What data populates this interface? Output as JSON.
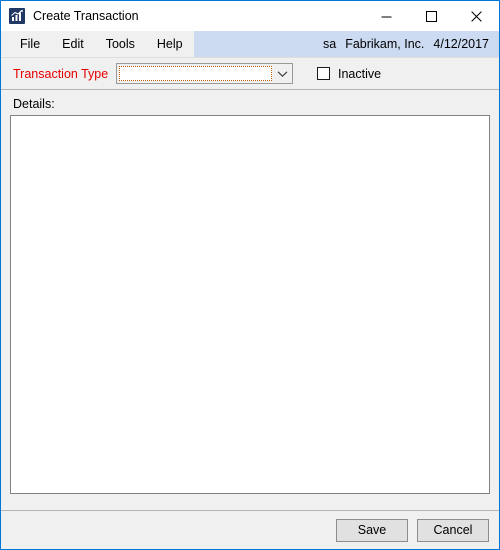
{
  "window": {
    "title": "Create Transaction",
    "icon": "bar-chart-icon",
    "accent_color": "#0078d7",
    "controls": [
      {
        "name": "minimize",
        "glyph": "minimize-icon"
      },
      {
        "name": "maximize",
        "glyph": "maximize-icon"
      },
      {
        "name": "close",
        "glyph": "close-icon"
      }
    ]
  },
  "menubar": {
    "items": [
      {
        "label": "File"
      },
      {
        "label": "Edit"
      },
      {
        "label": "Tools"
      },
      {
        "label": "Help"
      }
    ],
    "status": {
      "user": "sa",
      "company": "Fabrikam, Inc.",
      "date": "4/12/2017",
      "background_color": "#cddbf2"
    }
  },
  "form": {
    "transaction_type": {
      "label": "Transaction Type",
      "label_color": "#e60000",
      "required": true,
      "value": "",
      "placeholder": "",
      "focused": true,
      "focus_border_color": "#c05a00"
    },
    "inactive": {
      "label": "Inactive",
      "checked": false
    },
    "details": {
      "label": "Details:",
      "value": ""
    }
  },
  "footer": {
    "save_label": "Save",
    "cancel_label": "Cancel"
  }
}
